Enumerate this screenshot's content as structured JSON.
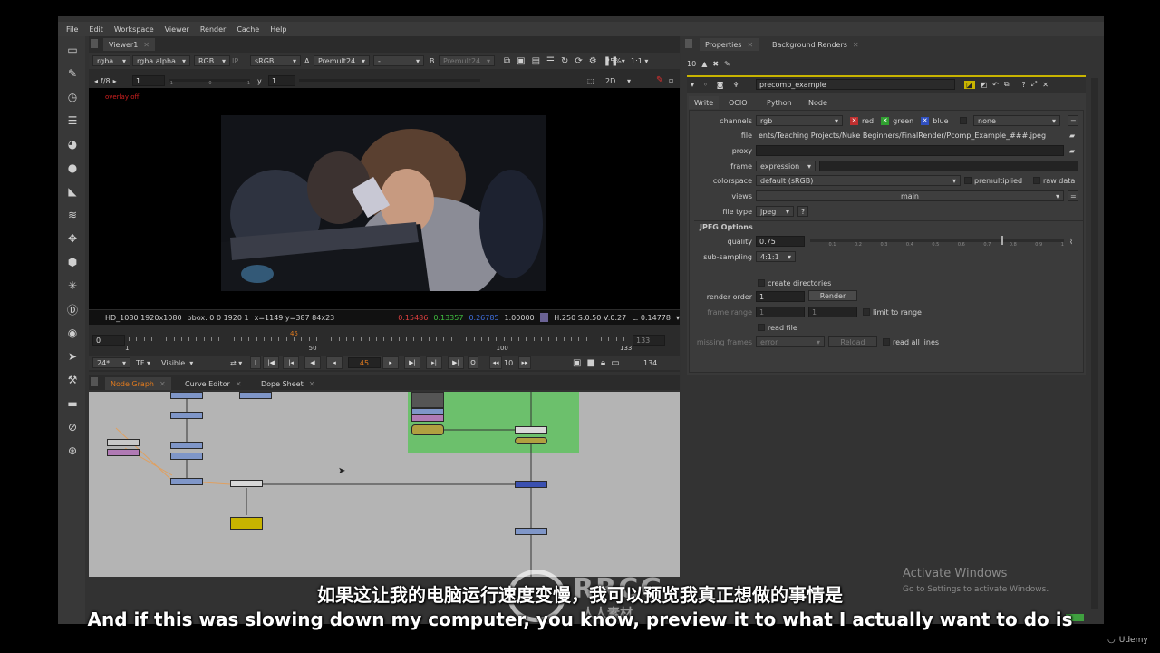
{
  "menu": [
    "File",
    "Edit",
    "Workspace",
    "Viewer",
    "Render",
    "Cache",
    "Help"
  ],
  "viewer": {
    "tab": "Viewer1",
    "channels": "rgba",
    "alpha": "rgba.alpha",
    "colorspace_mode": "RGB",
    "ip": "IP",
    "display": "sRGB",
    "input_a_label": "A",
    "input_a": "Premult24",
    "input_dash": "-",
    "input_b_label": "B",
    "input_b": "Premult24",
    "zoom": "25%",
    "ratio": "1:1",
    "fstop": "f/8",
    "gain": "1",
    "y_label": "y",
    "gamma": "1",
    "view_mode": "2D",
    "overlay": "overlay off",
    "gain_ticks": [
      "-1",
      "0",
      "1"
    ]
  },
  "info": {
    "format": "HD_1080 1920x1080",
    "bbox": "bbox: 0 0 1920 1",
    "coords": "x=1149 y=387 84x23",
    "r": "0.15486",
    "g": "0.13357",
    "b": "0.26785",
    "a": "1.00000",
    "hsv": "H:250 S:0.50 V:0.27",
    "lum": "L: 0.14778",
    "swatch": "#6a6294"
  },
  "timeline": {
    "start": "0",
    "ticks": [
      "1",
      "50",
      "100",
      "133"
    ],
    "end": "133",
    "current": "45",
    "current_frame": 45,
    "first_frame": 1,
    "last_frame": 133
  },
  "playbar": {
    "fps": "24*",
    "tf": "TF",
    "visible": "Visible",
    "frame": "45",
    "step": "10",
    "last": "134"
  },
  "tabs_bottom": [
    "Node Graph",
    "Curve Editor",
    "Dope Sheet"
  ],
  "properties": {
    "tab": "Properties",
    "tab2": "Background Renders",
    "count": "10",
    "node_name": "precomp_example",
    "subtabs": [
      "Write",
      "OCIO",
      "Python",
      "Node"
    ],
    "channels_label": "channels",
    "channels": "rgb",
    "red": "red",
    "green": "green",
    "blue": "blue",
    "none": "none",
    "file_label": "file",
    "file": "ents/Teaching Projects/Nuke Beginners/FinalRender/Pcomp_Example_###.jpeg",
    "proxy_label": "proxy",
    "frame_label": "frame",
    "frame": "expression",
    "colorspace_label": "colorspace",
    "colorspace": "default (sRGB)",
    "premultiplied": "premultiplied",
    "raw_data": "raw data",
    "views_label": "views",
    "views": "main",
    "file_type_label": "file type",
    "file_type": "jpeg",
    "help": "?",
    "jpeg_options": "JPEG Options",
    "quality_label": "quality",
    "quality": "0.75",
    "quality_ticks": [
      "0.1",
      "0.2",
      "0.3",
      "0.4",
      "0.5",
      "0.6",
      "0.7",
      "0.8",
      "0.9",
      "1"
    ],
    "subsampling_label": "sub-sampling",
    "subsampling": "4:1:1",
    "create_dirs": "create directories",
    "render_order_label": "render order",
    "render_order": "1",
    "render_button": "Render",
    "frame_range_label": "frame range",
    "frame_range_a": "1",
    "frame_range_b": "1",
    "limit_to_range": "limit to range",
    "read_file": "read file",
    "missing_frames_label": "missing frames",
    "missing_frames": "error",
    "reload": "Reload",
    "read_all_lines": "read all lines"
  },
  "watermark": {
    "title": "Activate Windows",
    "sub": "Go to Settings to activate Windows."
  },
  "subtitles": {
    "cn": "如果这让我的电脑运行速度变慢，我可以预览我真正想做的事情是",
    "en": "And if this was slowing down my computer, you know, preview it to what I actually want to do is"
  },
  "branding": {
    "logo": "RRCG",
    "logo_sub": "人人素材",
    "udemy": "Udemy"
  },
  "colors": {
    "accent_orange": "#e07a1e",
    "node_blue": "#7f96c8",
    "backdrop_green": "#6cc06c"
  }
}
